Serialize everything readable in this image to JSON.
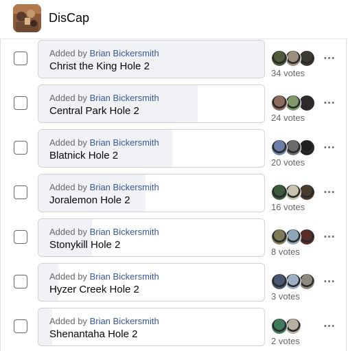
{
  "app": {
    "group_name": "DisCap"
  },
  "poll": {
    "options": [
      {
        "added_prefix": "Added by",
        "added_name": "Brian Bickersmith",
        "title": "Christ the King Hole 2",
        "votes_label": "34 votes",
        "votes": 34,
        "vote_share": 1.0,
        "voter_colors": [
          "#4e5a3a",
          "#9a8f7c",
          "#3d3b30"
        ]
      },
      {
        "added_prefix": "Added by",
        "added_name": "Brian Bickersmith",
        "title": "Central Park Hole 2",
        "votes_label": "24 votes",
        "votes": 24,
        "vote_share": 0.7,
        "voter_colors": [
          "#8e6b5f",
          "#7f9a6a",
          "#2f2a2a"
        ]
      },
      {
        "added_prefix": "Added by",
        "added_name": "Brian Bickersmith",
        "title": "Blatnick Hole 2",
        "votes_label": "20 votes",
        "votes": 20,
        "vote_share": 0.59,
        "voter_colors": [
          "#6a7ea8",
          "#6b6b6b",
          "#1f1f1f"
        ]
      },
      {
        "added_prefix": "Added by",
        "added_name": "Brian Bickersmith",
        "title": "Joralemon Hole 2",
        "votes_label": "16 votes",
        "votes": 16,
        "vote_share": 0.47,
        "voter_colors": [
          "#3d5a3f",
          "#c9c2b0",
          "#4a3b2f"
        ]
      },
      {
        "added_prefix": "Added by",
        "added_name": "Brian Bickersmith",
        "title": "Stonykill Hole 2",
        "votes_label": "8 votes",
        "votes": 8,
        "vote_share": 0.235,
        "voter_colors": [
          "#7d7a55",
          "#8fa6b8",
          "#5a2b27"
        ]
      },
      {
        "added_prefix": "Added by",
        "added_name": "Brian Bickersmith",
        "title": "Hyzer Creek Hole 2",
        "votes_label": "3 votes",
        "votes": 3,
        "vote_share": 0.088,
        "voter_colors": [
          "#4b5770",
          "#9fb0c4",
          "#8c8a7e"
        ]
      },
      {
        "added_prefix": "Added by",
        "added_name": "Brian Bickersmith",
        "title": "Shenantaha Hole 2",
        "votes_label": "2 votes",
        "votes": 2,
        "vote_share": 0.059,
        "voter_colors": [
          "#3f7a5a",
          "#b8b0a0"
        ]
      }
    ]
  },
  "icons": {
    "more": "⋯"
  }
}
